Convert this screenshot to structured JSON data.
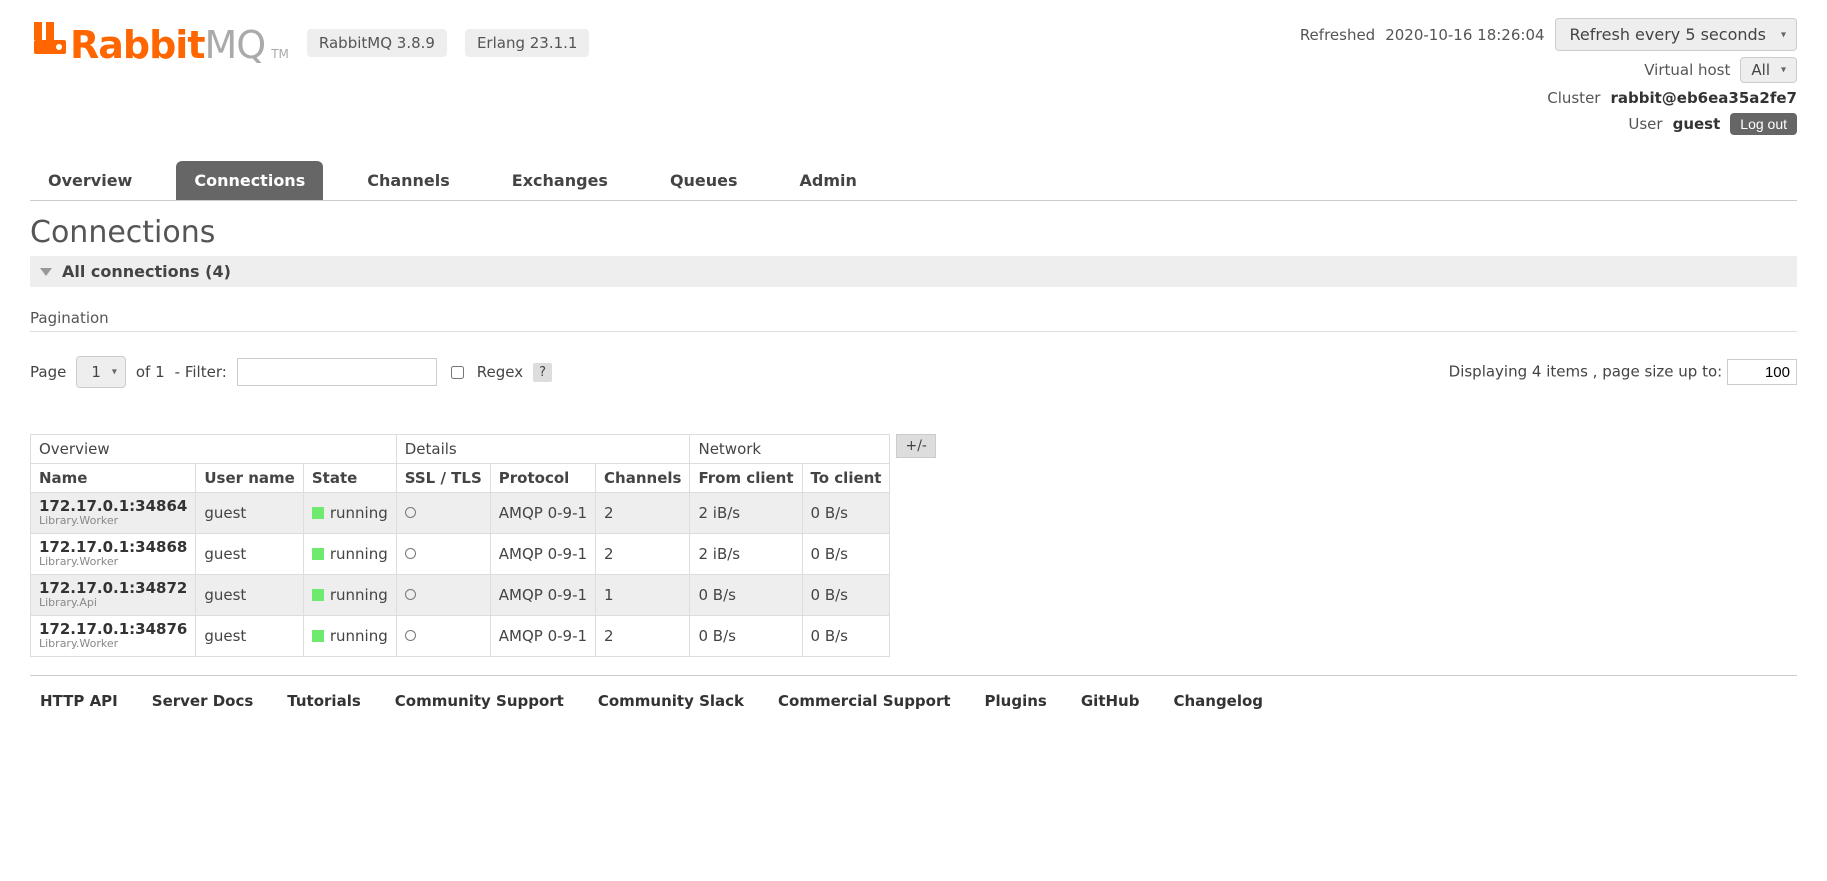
{
  "logo": {
    "part1": "Rabbit",
    "part2": "MQ",
    "tm": "TM"
  },
  "versions": {
    "rabbit": "RabbitMQ 3.8.9",
    "erlang": "Erlang 23.1.1"
  },
  "status": {
    "refreshed_label": "Refreshed",
    "refreshed_ts": "2020-10-16 18:26:04",
    "refresh_select": "Refresh every 5 seconds",
    "vhost_label": "Virtual host",
    "vhost_value": "All",
    "cluster_label": "Cluster",
    "cluster_value": "rabbit@eb6ea35a2fe7",
    "user_label": "User",
    "user_value": "guest",
    "logout": "Log out"
  },
  "tabs": {
    "overview": "Overview",
    "connections": "Connections",
    "channels": "Channels",
    "exchanges": "Exchanges",
    "queues": "Queues",
    "admin": "Admin"
  },
  "page": {
    "title": "Connections",
    "section": "All connections (4)",
    "pagination_label": "Pagination",
    "page_label": "Page",
    "page_current": "1",
    "page_of": "of 1",
    "filter_label": "- Filter:",
    "filter_value": "",
    "regex_label": "Regex",
    "regex_help": "?",
    "display_text": "Displaying 4 items , page size up to:",
    "page_size": "100",
    "plus_minus": "+/-"
  },
  "table": {
    "groups": {
      "overview": "Overview",
      "details": "Details",
      "network": "Network"
    },
    "cols": {
      "name": "Name",
      "user": "User name",
      "state": "State",
      "ssl": "SSL / TLS",
      "protocol": "Protocol",
      "channels": "Channels",
      "from": "From client",
      "to": "To client"
    },
    "rows": [
      {
        "name": "172.17.0.1:34864",
        "sub": "Library.Worker",
        "user": "guest",
        "state": "running",
        "protocol": "AMQP 0-9-1",
        "channels": "2",
        "from": "2 iB/s",
        "to": "0 B/s"
      },
      {
        "name": "172.17.0.1:34868",
        "sub": "Library.Worker",
        "user": "guest",
        "state": "running",
        "protocol": "AMQP 0-9-1",
        "channels": "2",
        "from": "2 iB/s",
        "to": "0 B/s"
      },
      {
        "name": "172.17.0.1:34872",
        "sub": "Library.Api",
        "user": "guest",
        "state": "running",
        "protocol": "AMQP 0-9-1",
        "channels": "1",
        "from": "0 B/s",
        "to": "0 B/s"
      },
      {
        "name": "172.17.0.1:34876",
        "sub": "Library.Worker",
        "user": "guest",
        "state": "running",
        "protocol": "AMQP 0-9-1",
        "channels": "2",
        "from": "0 B/s",
        "to": "0 B/s"
      }
    ]
  },
  "footer": {
    "http_api": "HTTP API",
    "server_docs": "Server Docs",
    "tutorials": "Tutorials",
    "community_support": "Community Support",
    "community_slack": "Community Slack",
    "commercial_support": "Commercial Support",
    "plugins": "Plugins",
    "github": "GitHub",
    "changelog": "Changelog"
  }
}
